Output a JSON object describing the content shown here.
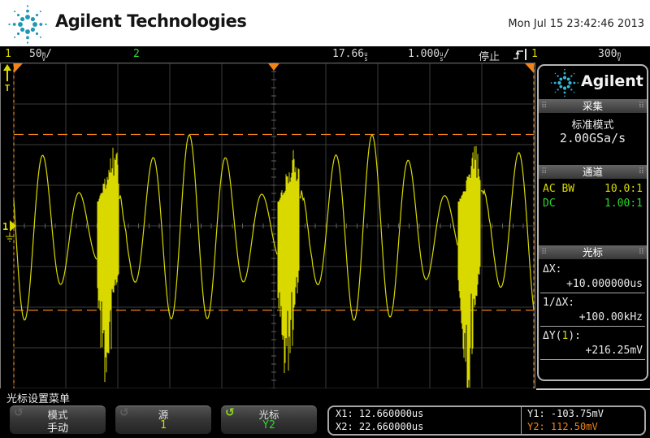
{
  "colors": {
    "channel1": "#d9d900",
    "channel2": "#2ed52e",
    "cursor": "#f08418",
    "grid": "#3a3a3a",
    "tick": "#606060",
    "frame": "#7d7d7d",
    "accent_green": "#8fdc1e",
    "logo_teal": "#1f97b6"
  },
  "header": {
    "brand": "Agilent Technologies",
    "datetime": "Mon Jul 15 23:42:46 2013"
  },
  "status": {
    "ch1": {
      "num": "1",
      "scale": "50",
      "unit_top": "m",
      "unit_bot": "V",
      "slash": "/"
    },
    "ch2": {
      "num": "2"
    },
    "delay": {
      "value": "17.66",
      "unit_top": "u",
      "unit_bot": "s"
    },
    "timebase": {
      "value": "1.000",
      "unit_top": "u",
      "unit_bot": "s",
      "slash": "/"
    },
    "run_state": "停止",
    "trigger": {
      "source": "1",
      "level": "300",
      "unit_top": "m",
      "unit_bot": "V"
    }
  },
  "sidebar": {
    "brand": "Agilent",
    "acquire": {
      "title": "采集",
      "mode": "标准模式",
      "rate": "2.00GSa/s"
    },
    "channels": {
      "title": "通道",
      "rows": [
        {
          "label": "AC BW",
          "ratio": "10.0:1"
        },
        {
          "label": "DC",
          "ratio": "1.00:1"
        }
      ]
    },
    "cursors_panel": {
      "title": "光标",
      "dx_label": "ΔX:",
      "dx_value": "+10.000000us",
      "inv_label": "1/ΔX:",
      "inv_value": "+100.00kHz",
      "dy_pre": "ΔY(",
      "dy_src": "1",
      "dy_post": "):",
      "dy_value": "+216.25mV"
    }
  },
  "menu": {
    "title": "光标设置菜单",
    "softkeys": [
      {
        "label": "模式",
        "value": "手动"
      },
      {
        "label": "源",
        "value": "1"
      },
      {
        "label": "光标",
        "value": "Y2"
      }
    ],
    "readout": {
      "x1": "X1: 12.660000us",
      "x2": "X2: 22.660000us",
      "y1": "Y1: -103.75mV",
      "y2": "Y2: 112.50mV"
    }
  },
  "display_markers": {
    "trigger_level": "T",
    "ch1": "1"
  },
  "chart_data": {
    "type": "line",
    "title": "Oscilloscope channel 1 trace",
    "x_units": "us",
    "y_units": "mV",
    "volts_per_div_mV": 50,
    "time_per_div_us": 1.0,
    "sample_rate": "2.00GSa/s",
    "delay_us": 17.66,
    "x_range_us": [
      12.66,
      22.66
    ],
    "y_range_mV": [
      -200,
      200
    ],
    "divisions": {
      "x": 10,
      "y": 8
    },
    "cursors": {
      "x1_us": 12.66,
      "x2_us": 22.66,
      "y1_mV": -103.75,
      "y2_mV": 112.5,
      "dx_us": 10.0,
      "inv_dx_kHz": 100.0,
      "dy_mV": 216.25
    },
    "trigger": {
      "source": 1,
      "level_mV": 300,
      "slope": "rising",
      "position_us": 17.66
    },
    "waveform": {
      "description": "~1.4MHz amplitude-modulated sine with large high-frequency transient bursts every ~3.47us; negative spikes to about -190mV",
      "baseline_mV": -5,
      "base_period_us": 0.703,
      "peak_ref_us": 16.035,
      "amplitude_mV_min": 37,
      "amplitude_mV_max": 117,
      "am_period_us": 3.47,
      "burst_centers_us": [
        14.47,
        17.94,
        21.41
      ],
      "burst_min_mV": -190,
      "burst_max_mV": 105
    }
  }
}
